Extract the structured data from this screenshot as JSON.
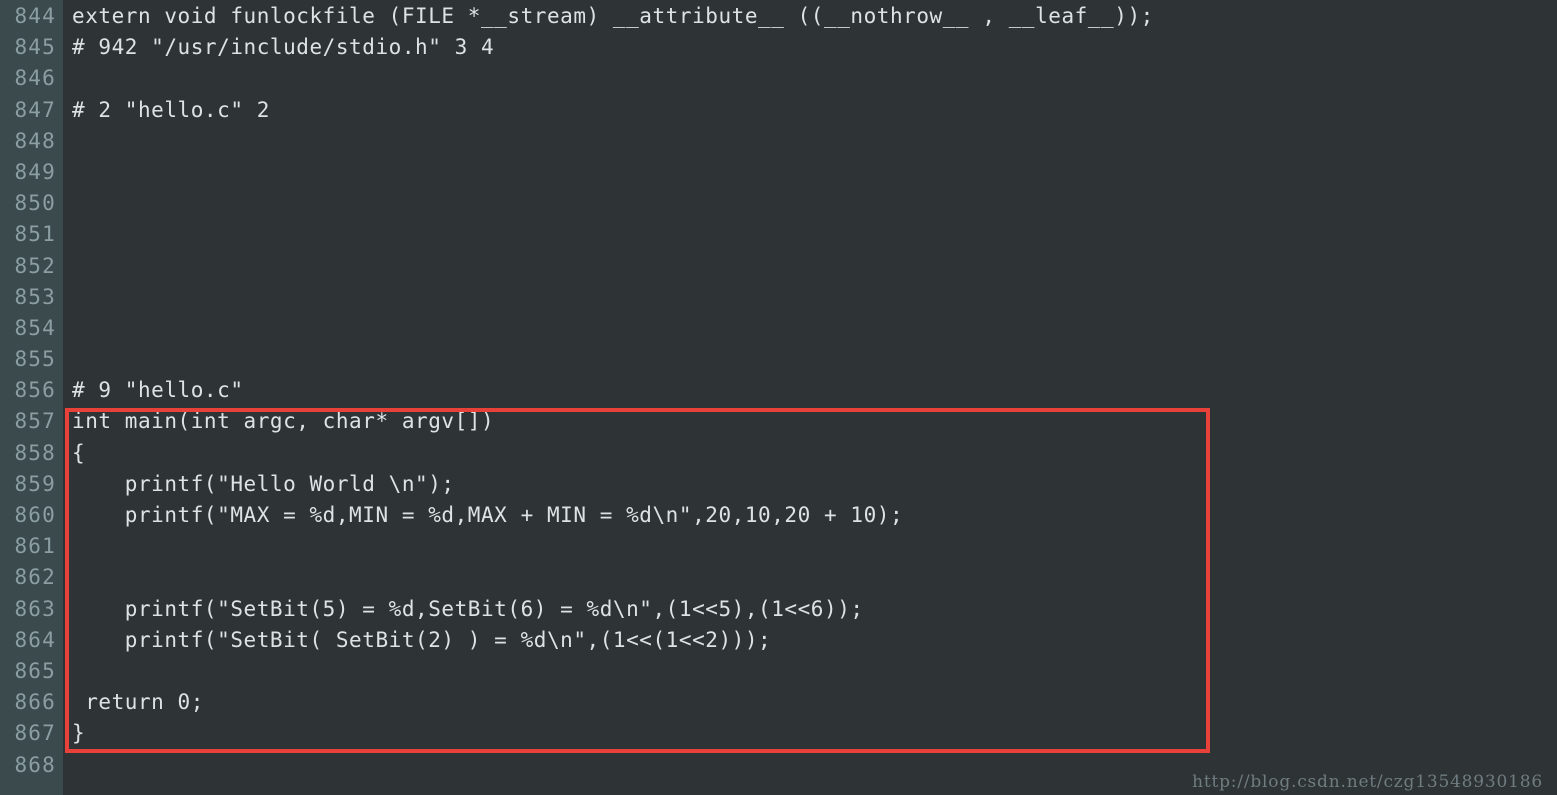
{
  "editor": {
    "title": "C source preprocessed output viewer",
    "language": "c",
    "theme_colors": {
      "code_background": "#2e3336",
      "gutter_background": "#3b4a4d",
      "code_text": "#dde3e5",
      "line_number_text": "#8b9ea1",
      "highlight_box": "#e8413a",
      "watermark_text": "#6f7c80"
    },
    "first_line_number": 844,
    "last_line_number": 868
  },
  "lines": [
    {
      "number": "844",
      "text": "extern void funlockfile (FILE *__stream) __attribute__ ((__nothrow__ , __leaf__));"
    },
    {
      "number": "845",
      "text": "# 942 \"/usr/include/stdio.h\" 3 4"
    },
    {
      "number": "846",
      "text": ""
    },
    {
      "number": "847",
      "text": "# 2 \"hello.c\" 2"
    },
    {
      "number": "848",
      "text": ""
    },
    {
      "number": "849",
      "text": ""
    },
    {
      "number": "850",
      "text": ""
    },
    {
      "number": "851",
      "text": ""
    },
    {
      "number": "852",
      "text": ""
    },
    {
      "number": "853",
      "text": ""
    },
    {
      "number": "854",
      "text": ""
    },
    {
      "number": "855",
      "text": ""
    },
    {
      "number": "856",
      "text": "# 9 \"hello.c\""
    },
    {
      "number": "857",
      "text": "int main(int argc, char* argv[])"
    },
    {
      "number": "858",
      "text": "{"
    },
    {
      "number": "859",
      "text": "    printf(\"Hello World \\n\");"
    },
    {
      "number": "860",
      "text": "    printf(\"MAX = %d,MIN = %d,MAX + MIN = %d\\n\",20,10,20 + 10);"
    },
    {
      "number": "861",
      "text": ""
    },
    {
      "number": "862",
      "text": ""
    },
    {
      "number": "863",
      "text": "    printf(\"SetBit(5) = %d,SetBit(6) = %d\\n\",(1<<5),(1<<6));"
    },
    {
      "number": "864",
      "text": "    printf(\"SetBit( SetBit(2) ) = %d\\n\",(1<<(1<<2)));"
    },
    {
      "number": "865",
      "text": ""
    },
    {
      "number": "866",
      "text": " return 0;"
    },
    {
      "number": "867",
      "text": "}"
    },
    {
      "number": "868",
      "text": ""
    }
  ],
  "highlight": {
    "label": "red-annotation-rectangle",
    "covers_lines_from": "857",
    "covers_lines_to": "867"
  },
  "watermark": {
    "text": "http://blog.csdn.net/czg13548930186"
  }
}
